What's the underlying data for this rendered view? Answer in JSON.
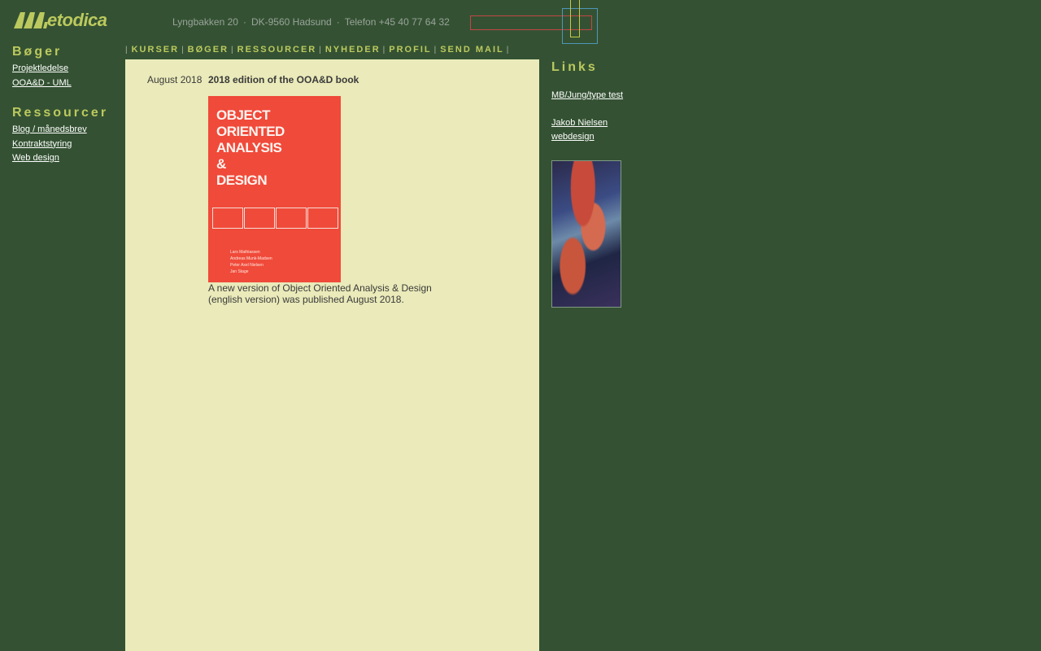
{
  "header": {
    "logo_text": "etodica",
    "address": "Lyngbakken 20",
    "city": "DK-9560 Hadsund",
    "phone": "Telefon +45 40 77 64 32",
    "separator": "·"
  },
  "left_sidebar": {
    "section1_title": "Bøger",
    "section1_items": [
      "Projektledelse",
      "OOA&D - UML"
    ],
    "section2_title": "Ressourcer",
    "section2_items": [
      "Blog / månedsbrev",
      "Kontraktstyring",
      "Web design"
    ]
  },
  "top_nav": {
    "divider": "|",
    "items": [
      "KURSER",
      "BØGER",
      "RESSOURCER",
      "NYHEDER",
      "PROFIL",
      "SEND MAIL"
    ]
  },
  "news": {
    "date": "August 2018",
    "title": "2018 edition of the OOA&D book",
    "body": "A new version of Object Oriented Analysis & Design (english version) was published August 2018."
  },
  "book_cover": {
    "title_lines": [
      "OBJECT",
      "ORIENTED",
      "ANALYSIS",
      "&",
      "DESIGN"
    ],
    "authors": [
      "Lars Mathiassen",
      "Andreas Munk-Madsen",
      "Peter Axel Nielsen",
      "Jan Stage"
    ]
  },
  "right_sidebar": {
    "title": "Links",
    "link1": "MB/Jung/type test",
    "link2_line1": "Jakob Nielsen",
    "link2_line2": "webdesign"
  },
  "colors": {
    "background": "#345233",
    "content": "#eaeaba",
    "accent": "#bcc95e",
    "book": "#f04a3a"
  }
}
